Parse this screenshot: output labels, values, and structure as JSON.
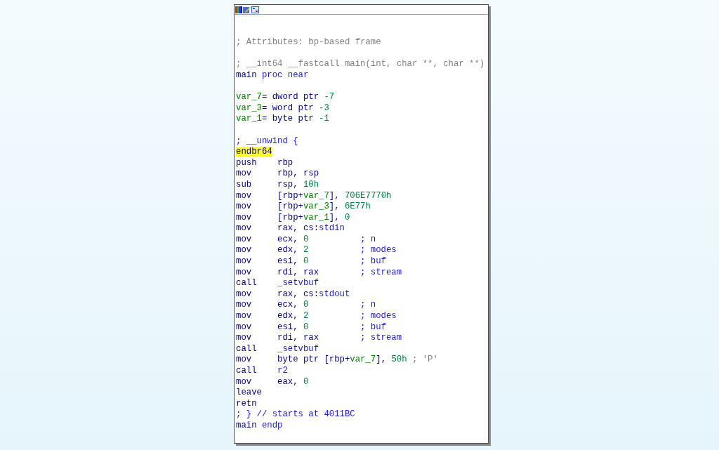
{
  "lines": [
    {
      "kind": "blank"
    },
    {
      "kind": "blank"
    },
    {
      "kind": "text",
      "segments": [
        {
          "text": "; Attributes: bp-based frame",
          "kind": "note"
        }
      ]
    },
    {
      "kind": "blank"
    },
    {
      "kind": "text",
      "segments": [
        {
          "text": "; __int64 __fastcall main(int, char **, char **)",
          "kind": "note"
        }
      ]
    },
    {
      "kind": "text",
      "segments": [
        {
          "text": "main",
          "kind": "plain"
        },
        {
          "text": " proc near",
          "kind": "name"
        }
      ]
    },
    {
      "kind": "blank"
    },
    {
      "kind": "text",
      "segments": [
        {
          "text": "var_7",
          "kind": "var"
        },
        {
          "text": "= dword ptr ",
          "kind": "plain"
        },
        {
          "text": "-7",
          "kind": "number"
        }
      ]
    },
    {
      "kind": "text",
      "segments": [
        {
          "text": "var_3",
          "kind": "var"
        },
        {
          "text": "= word ptr ",
          "kind": "plain"
        },
        {
          "text": "-3",
          "kind": "number"
        }
      ]
    },
    {
      "kind": "text",
      "segments": [
        {
          "text": "var_1",
          "kind": "var"
        },
        {
          "text": "= byte ptr ",
          "kind": "plain"
        },
        {
          "text": "-1",
          "kind": "number"
        }
      ]
    },
    {
      "kind": "blank"
    },
    {
      "kind": "text",
      "segments": [
        {
          "text": "; __unwind {",
          "kind": "name"
        }
      ]
    },
    {
      "kind": "text",
      "segments": [
        {
          "text": "endbr64",
          "kind": "mark"
        }
      ]
    },
    {
      "kind": "insn",
      "mnemonic": "push",
      "operands": [
        {
          "text": "rbp",
          "kind": "plain"
        }
      ]
    },
    {
      "kind": "insn",
      "mnemonic": "mov",
      "operands": [
        {
          "text": "rbp, rsp",
          "kind": "plain"
        }
      ]
    },
    {
      "kind": "insn",
      "mnemonic": "sub",
      "operands": [
        {
          "text": "rsp, ",
          "kind": "plain"
        },
        {
          "text": "10h",
          "kind": "number"
        }
      ]
    },
    {
      "kind": "insn",
      "mnemonic": "mov",
      "operands": [
        {
          "text": "[rbp+",
          "kind": "plain"
        },
        {
          "text": "var_7",
          "kind": "var"
        },
        {
          "text": "], ",
          "kind": "plain"
        },
        {
          "text": "706E7770h",
          "kind": "number"
        }
      ]
    },
    {
      "kind": "insn",
      "mnemonic": "mov",
      "operands": [
        {
          "text": "[rbp+",
          "kind": "plain"
        },
        {
          "text": "var_3",
          "kind": "var"
        },
        {
          "text": "], ",
          "kind": "plain"
        },
        {
          "text": "6E77h",
          "kind": "number"
        }
      ]
    },
    {
      "kind": "insn",
      "mnemonic": "mov",
      "operands": [
        {
          "text": "[rbp+",
          "kind": "plain"
        },
        {
          "text": "var_1",
          "kind": "var"
        },
        {
          "text": "], ",
          "kind": "plain"
        },
        {
          "text": "0",
          "kind": "number"
        }
      ]
    },
    {
      "kind": "insn",
      "mnemonic": "mov",
      "operands": [
        {
          "text": "rax, cs:",
          "kind": "plain"
        },
        {
          "text": "stdin",
          "kind": "name"
        }
      ]
    },
    {
      "kind": "insn",
      "mnemonic": "mov",
      "operands": [
        {
          "text": "ecx, ",
          "kind": "plain"
        },
        {
          "text": "0",
          "kind": "number"
        }
      ],
      "comment": [
        {
          "text": "; n",
          "kind": "name"
        }
      ]
    },
    {
      "kind": "insn",
      "mnemonic": "mov",
      "operands": [
        {
          "text": "edx, ",
          "kind": "plain"
        },
        {
          "text": "2",
          "kind": "number"
        }
      ],
      "comment": [
        {
          "text": "; modes",
          "kind": "name"
        }
      ]
    },
    {
      "kind": "insn",
      "mnemonic": "mov",
      "operands": [
        {
          "text": "esi, ",
          "kind": "plain"
        },
        {
          "text": "0",
          "kind": "number"
        }
      ],
      "comment": [
        {
          "text": "; buf",
          "kind": "name"
        }
      ]
    },
    {
      "kind": "insn",
      "mnemonic": "mov",
      "operands": [
        {
          "text": "rdi, rax",
          "kind": "plain"
        }
      ],
      "comment": [
        {
          "text": "; stream",
          "kind": "name"
        }
      ]
    },
    {
      "kind": "insn",
      "mnemonic": "call",
      "operands": [
        {
          "text": "_setvbuf",
          "kind": "name"
        }
      ]
    },
    {
      "kind": "insn",
      "mnemonic": "mov",
      "operands": [
        {
          "text": "rax, cs:",
          "kind": "plain"
        },
        {
          "text": "stdout",
          "kind": "name"
        }
      ]
    },
    {
      "kind": "insn",
      "mnemonic": "mov",
      "operands": [
        {
          "text": "ecx, ",
          "kind": "plain"
        },
        {
          "text": "0",
          "kind": "number"
        }
      ],
      "comment": [
        {
          "text": "; n",
          "kind": "name"
        }
      ]
    },
    {
      "kind": "insn",
      "mnemonic": "mov",
      "operands": [
        {
          "text": "edx, ",
          "kind": "plain"
        },
        {
          "text": "2",
          "kind": "number"
        }
      ],
      "comment": [
        {
          "text": "; modes",
          "kind": "name"
        }
      ]
    },
    {
      "kind": "insn",
      "mnemonic": "mov",
      "operands": [
        {
          "text": "esi, ",
          "kind": "plain"
        },
        {
          "text": "0",
          "kind": "number"
        }
      ],
      "comment": [
        {
          "text": "; buf",
          "kind": "name"
        }
      ]
    },
    {
      "kind": "insn",
      "mnemonic": "mov",
      "operands": [
        {
          "text": "rdi, rax",
          "kind": "plain"
        }
      ],
      "comment": [
        {
          "text": "; stream",
          "kind": "name"
        }
      ]
    },
    {
      "kind": "insn",
      "mnemonic": "call",
      "operands": [
        {
          "text": "_setvbuf",
          "kind": "name"
        }
      ]
    },
    {
      "kind": "insn",
      "mnemonic": "mov",
      "operands": [
        {
          "text": "byte ptr [rbp+",
          "kind": "plain"
        },
        {
          "text": "var_7",
          "kind": "var"
        },
        {
          "text": "], ",
          "kind": "plain"
        },
        {
          "text": "50h",
          "kind": "number"
        }
      ],
      "comment": [
        {
          "text": "; 'P'",
          "kind": "note"
        }
      ]
    },
    {
      "kind": "insn",
      "mnemonic": "call",
      "operands": [
        {
          "text": "r2",
          "kind": "name"
        }
      ]
    },
    {
      "kind": "insn",
      "mnemonic": "mov",
      "operands": [
        {
          "text": "eax, ",
          "kind": "plain"
        },
        {
          "text": "0",
          "kind": "number"
        }
      ]
    },
    {
      "kind": "insn",
      "mnemonic": "leave"
    },
    {
      "kind": "insn",
      "mnemonic": "retn"
    },
    {
      "kind": "text",
      "segments": [
        {
          "text": "; } // starts at 4011BC",
          "kind": "name"
        }
      ]
    },
    {
      "kind": "text",
      "segments": [
        {
          "text": "main",
          "kind": "plain"
        },
        {
          "text": " endp",
          "kind": "name"
        }
      ]
    }
  ]
}
